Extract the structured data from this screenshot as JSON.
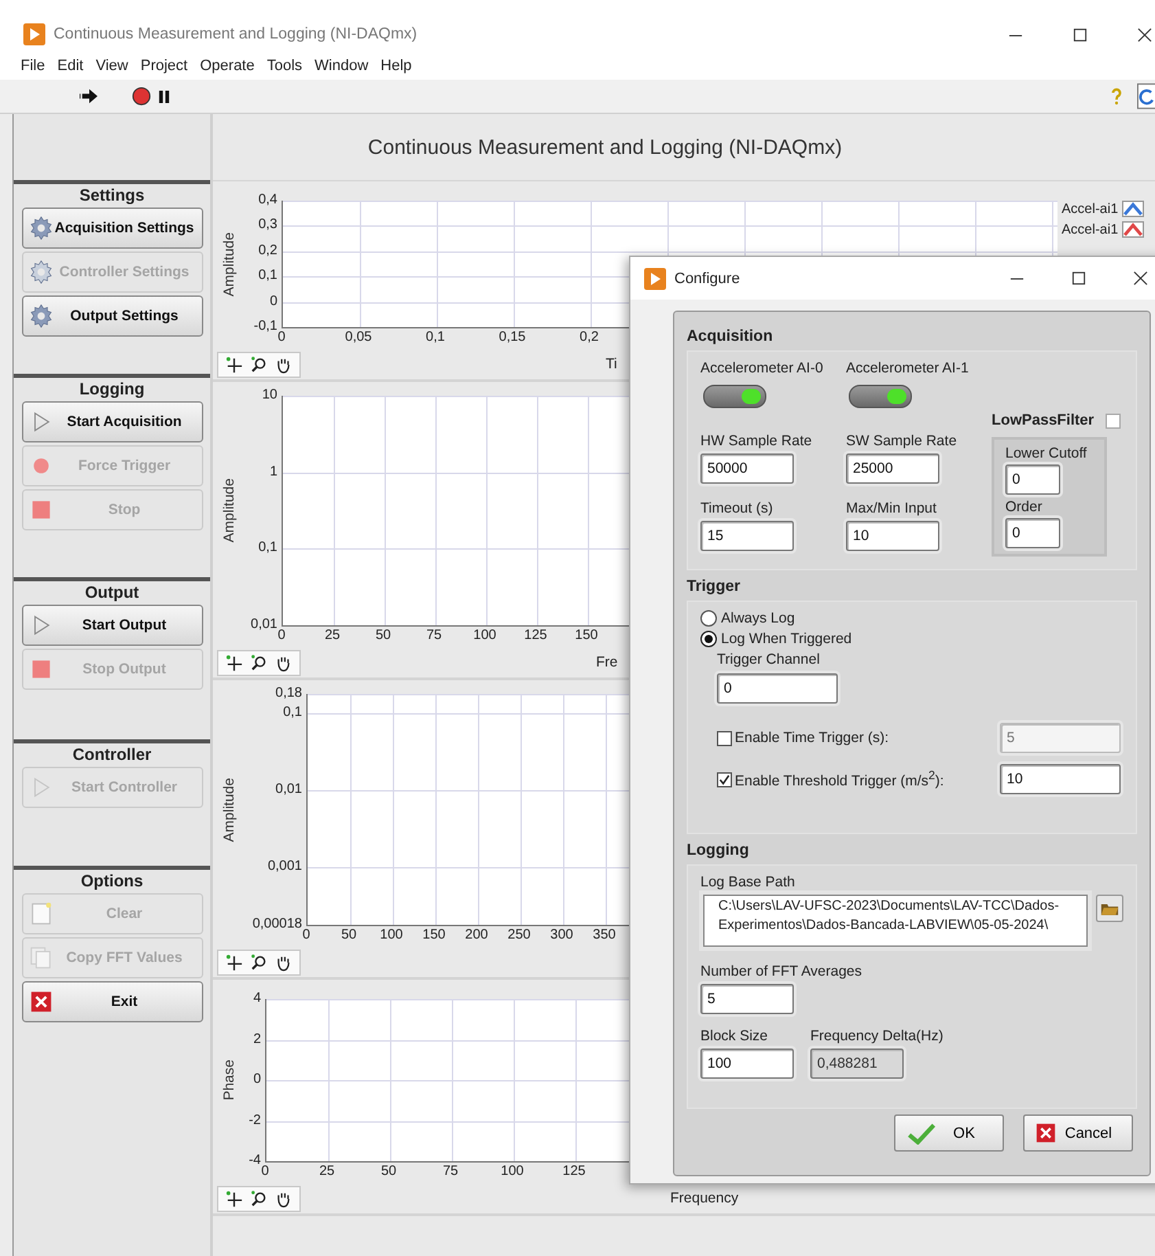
{
  "window": {
    "title": "Continuous Measurement and Logging (NI-DAQmx)"
  },
  "menu": [
    "File",
    "Edit",
    "View",
    "Project",
    "Operate",
    "Tools",
    "Window",
    "Help"
  ],
  "heading": "Continuous Measurement and Logging (NI-DAQmx)",
  "side_sections": [
    {
      "title": "Settings",
      "buttons": [
        {
          "label": "Acquisition Settings",
          "kind": "gear",
          "disabled": false
        },
        {
          "label": "Controller Settings",
          "kind": "gear",
          "disabled": true
        },
        {
          "label": "Output Settings",
          "kind": "gear",
          "disabled": false
        }
      ]
    },
    {
      "title": "Logging",
      "buttons": [
        {
          "label": "Start Acquisition",
          "kind": "play",
          "disabled": false
        },
        {
          "label": "Force Trigger",
          "kind": "dot",
          "disabled": true
        },
        {
          "label": "Stop",
          "kind": "square",
          "disabled": true
        }
      ]
    },
    {
      "title": "Output",
      "buttons": [
        {
          "label": "Start Output",
          "kind": "play",
          "disabled": false
        },
        {
          "label": "Stop Output",
          "kind": "square",
          "disabled": true
        }
      ]
    },
    {
      "title": "Controller",
      "buttons": [
        {
          "label": "Start Controller",
          "kind": "play",
          "disabled": true
        }
      ]
    },
    {
      "title": "Options",
      "buttons": [
        {
          "label": "Clear",
          "kind": "page",
          "disabled": true
        },
        {
          "label": "Copy FFT Values",
          "kind": "copy",
          "disabled": true
        },
        {
          "label": "Exit",
          "kind": "close",
          "disabled": false
        }
      ]
    }
  ],
  "charts": [
    {
      "y_label": "Amplitude",
      "kind": "linear",
      "y_ticks": [
        "0,4",
        "0,3",
        "0,2",
        "0,1",
        "0",
        "-0,1"
      ],
      "x_ticks": [
        "0",
        "0,05",
        "0,1",
        "0,15",
        "0,2"
      ],
      "x_label": "Ti",
      "legend": [
        {
          "label": "Accel-ai1",
          "color": "#3a78d8"
        },
        {
          "label": "Accel-ai1",
          "color": "#e04848"
        }
      ]
    },
    {
      "y_label": "Amplitude",
      "kind": "log",
      "y_ticks": [
        "10",
        "1",
        "0,1",
        "0,01"
      ],
      "x_ticks": [
        "0",
        "25",
        "50",
        "75",
        "100",
        "125",
        "150"
      ],
      "x_label": "Fre"
    },
    {
      "y_label": "Amplitude",
      "kind": "log",
      "y_ticks": [
        "0,18",
        "0,1",
        "0,01",
        "0,001",
        "0,00018"
      ],
      "x_ticks": [
        "0",
        "50",
        "100",
        "150",
        "200",
        "250",
        "300",
        "350"
      ]
    },
    {
      "y_label": "Phase",
      "kind": "linear",
      "y_ticks": [
        "4",
        "2",
        "0",
        "-2",
        "-4"
      ],
      "x_ticks": [
        "0",
        "25",
        "50",
        "75",
        "100",
        "125"
      ],
      "x_label": "Frequency"
    }
  ],
  "dialog": {
    "title": "Configure",
    "acquisition": {
      "title": "Acquisition",
      "channels": [
        {
          "label": "Accelerometer AI-0",
          "on": true
        },
        {
          "label": "Accelerometer AI-1",
          "on": true
        }
      ],
      "fields": [
        {
          "label": "HW Sample Rate",
          "value": "50000"
        },
        {
          "label": "SW Sample Rate",
          "value": "25000"
        },
        {
          "label": "Timeout (s)",
          "value": "15"
        },
        {
          "label": "Max/Min Input",
          "value": "10"
        }
      ],
      "filter": {
        "label": "LowPassFilter",
        "checked": false,
        "fields": [
          {
            "label": "Lower Cutoff",
            "value": "0"
          },
          {
            "label": "Order",
            "value": "0"
          }
        ]
      }
    },
    "trigger": {
      "title": "Trigger",
      "modes": [
        {
          "label": "Always Log",
          "selected": false
        },
        {
          "label": "Log When Triggered",
          "selected": true
        }
      ],
      "channel": {
        "label": "Trigger Channel",
        "value": "0"
      },
      "options": [
        {
          "label": "Enable Time Trigger (s):",
          "checked": false,
          "value": "5"
        },
        {
          "label": "Enable Threshold Trigger (m/s$^{2}$):",
          "checked": true,
          "value": "10"
        }
      ]
    },
    "logging": {
      "title": "Logging",
      "path_label": "Log Base Path",
      "path": "C:\\Users\\LAV-UFSC-2023\\Documents\\LAV-TCC\\Dados-\nExperimentos\\Dados-Bancada-LABVIEW\\05-05-2024\\",
      "fft_label": "Number of FFT Averages",
      "fft": "5",
      "block_label": "Block Size",
      "block": "100",
      "delta_label": "Frequency Delta(Hz)",
      "delta": "0,488281"
    },
    "buttons": [
      {
        "label": "OK",
        "kind": "ok"
      },
      {
        "label": "Cancel",
        "kind": "cancel"
      }
    ]
  }
}
